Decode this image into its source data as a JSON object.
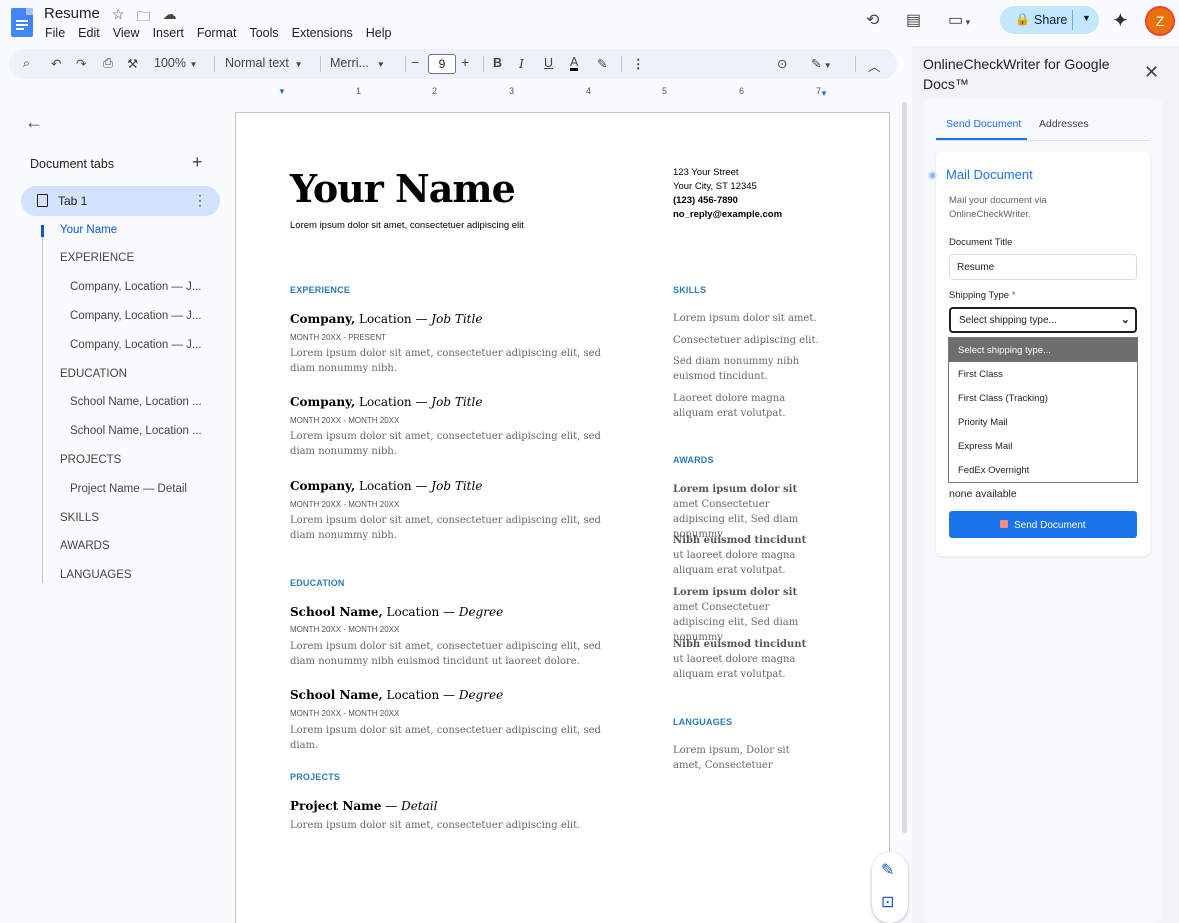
{
  "app": {
    "doc_title": "Resume",
    "menu": [
      "File",
      "Edit",
      "View",
      "Insert",
      "Format",
      "Tools",
      "Extensions",
      "Help"
    ],
    "share_label": "Share",
    "avatar_letter": "Z"
  },
  "toolbar": {
    "zoom": "100%",
    "style": "Normal text",
    "font": "Merri...",
    "font_size": "9",
    "bold": "B",
    "italic": "I",
    "underline": "U",
    "text_color": "A"
  },
  "ruler": [
    "1",
    "1",
    "2",
    "3",
    "4",
    "5",
    "6",
    "7"
  ],
  "tabs_panel": {
    "title": "Document tabs",
    "tab1_label": "Tab 1",
    "outline": [
      "Your Name",
      "EXPERIENCE",
      "Company, Location — J...",
      "Company, Location — J...",
      "Company, Location — J...",
      "EDUCATION",
      "School Name, Location ...",
      "School Name, Location ...",
      "PROJECTS",
      "Project Name — Detail",
      "SKILLS",
      "AWARDS",
      "LANGUAGES"
    ]
  },
  "resume": {
    "name": "Your Name",
    "tagline": "Lorem ipsum dolor sit amet, consectetuer adipiscing elit",
    "contact": {
      "street": "123 Your Street",
      "city": "Your City, ST 12345",
      "phone": "(123) 456-7890",
      "email": "no_reply@example.com"
    },
    "experience_h": "EXPERIENCE",
    "experience": [
      {
        "company": "Company,",
        "loc": " Location — ",
        "title": "Job Title",
        "dates": "MONTH 20XX - PRESENT",
        "text": "Lorem ipsum dolor sit amet, consectetuer adipiscing elit, sed diam nonummy nibh."
      },
      {
        "company": "Company,",
        "loc": " Location — ",
        "title": "Job Title",
        "dates": "MONTH 20XX - MONTH 20XX",
        "text": "Lorem ipsum dolor sit amet, consectetuer adipiscing elit, sed diam nonummy nibh."
      },
      {
        "company": "Company,",
        "loc": " Location — ",
        "title": "Job Title",
        "dates": "MONTH 20XX - MONTH 20XX",
        "text": "Lorem ipsum dolor sit amet, consectetuer adipiscing elit, sed diam nonummy nibh."
      }
    ],
    "education_h": "EDUCATION",
    "education": [
      {
        "school": "School Name,",
        "loc": " Location — ",
        "degree": "Degree",
        "dates": "MONTH 20XX - MONTH 20XX",
        "text": "Lorem ipsum dolor sit amet, consectetuer adipiscing elit, sed diam nonummy nibh euismod tincidunt ut laoreet dolore."
      },
      {
        "school": "School Name,",
        "loc": " Location — ",
        "degree": "Degree",
        "dates": "MONTH 20XX - MONTH 20XX",
        "text": "Lorem ipsum dolor sit amet, consectetuer adipiscing elit, sed diam."
      }
    ],
    "projects_h": "PROJECTS",
    "project": {
      "name": "Project Name",
      "sep": " — ",
      "detail": "Detail",
      "text": "Lorem ipsum dolor sit amet, consectetuer adipiscing elit."
    },
    "skills_h": "SKILLS",
    "skills": [
      "Lorem ipsum dolor sit amet.",
      "Consectetuer adipiscing elit.",
      "Sed diam nonummy nibh euismod tincidunt.",
      "Laoreet dolore magna aliquam erat volutpat."
    ],
    "awards_h": "AWARDS",
    "awards": [
      {
        "b": "Lorem ipsum dolor sit",
        "t": " amet Consectetuer adipiscing elit, Sed diam nonummy"
      },
      {
        "b": "Nibh euismod tincidunt",
        "t": " ut laoreet dolore magna aliquam erat volutpat."
      },
      {
        "b": "Lorem ipsum dolor sit",
        "t": " amet Consectetuer adipiscing elit, Sed diam nonummy"
      },
      {
        "b": "Nibh euismod tincidunt",
        "t": " ut laoreet dolore magna aliquam erat volutpat."
      }
    ],
    "languages_h": "LANGUAGES",
    "languages": "Lorem ipsum, Dolor sit amet, Consectetuer"
  },
  "side_panel": {
    "title": "OnlineCheckWriter for Google Docs™",
    "tabs": [
      "Send Document",
      "Addresses"
    ],
    "card_title": "Mail Document",
    "card_desc": "Mail your document via OnlineCheckWriter.",
    "doc_title_label": "Document Title",
    "doc_title_value": "Resume",
    "shipping_label": "Shipping Type",
    "required_mark": "*",
    "shipping_selected": "Select shipping type...",
    "shipping_options": [
      "Select shipping type...",
      "First Class",
      "First Class (Tracking)",
      "Priority Mail",
      "Express Mail",
      "FedEx Overnight"
    ],
    "none_available": "none available",
    "send_button": "Send Document"
  }
}
